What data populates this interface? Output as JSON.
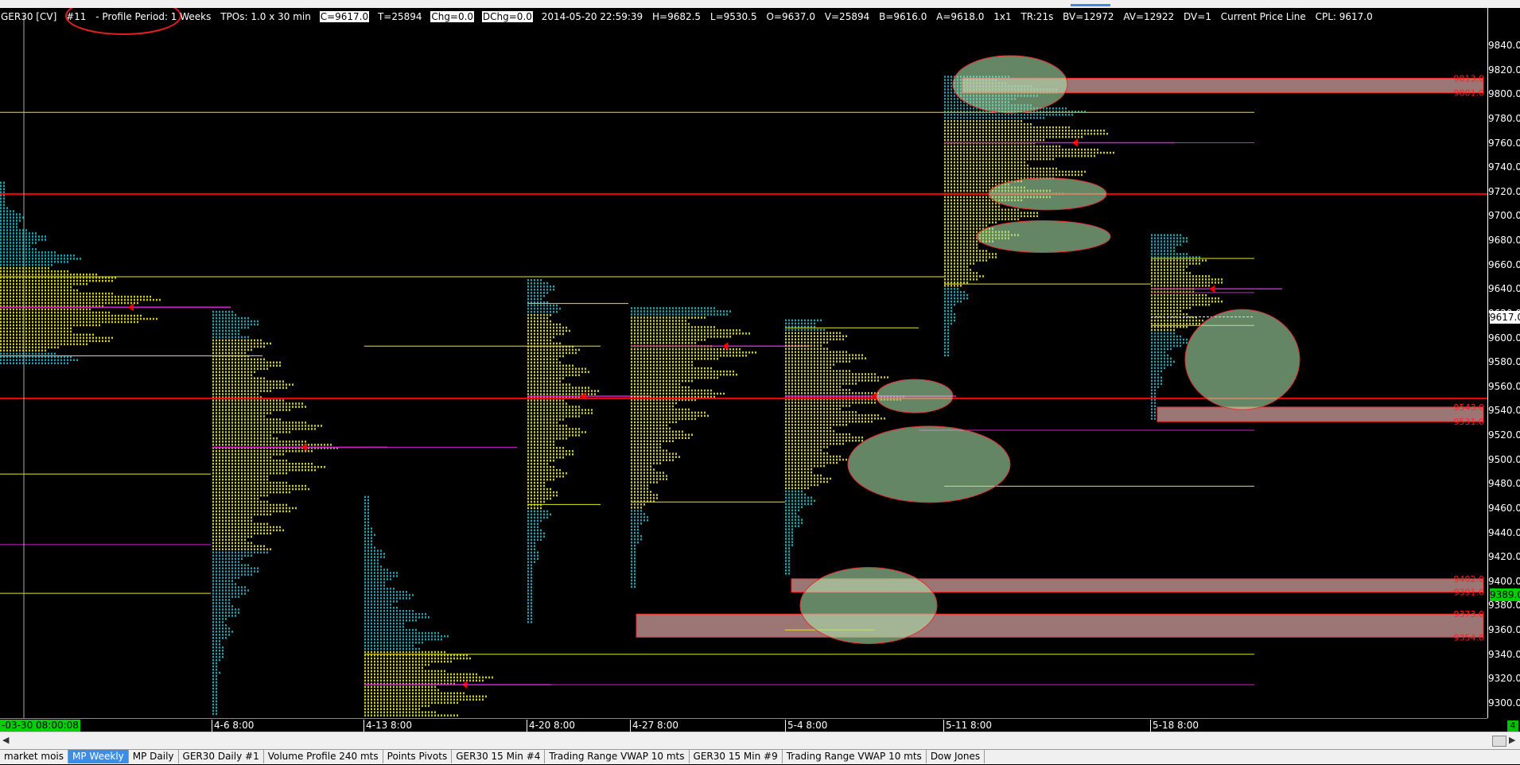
{
  "header": {
    "symbol": "GER30 [CV]",
    "chart_num": "#11",
    "profile_period": "- Profile Period: 1 Weeks",
    "tpos": "TPOs: 1.0 x 30 min",
    "close": "C=9617.0",
    "ticks": "T=25894",
    "chg": "Chg=0.0",
    "dchg": "DChg=0.0",
    "datetime": "2014-05-20 22:59:39",
    "high": "H=9682.5",
    "low": "L=9530.5",
    "open": "O=9637.0",
    "volume": "V=25894",
    "bid": "B=9616.0",
    "ask": "A=9618.0",
    "size": "1x1",
    "tr": "TR:21s",
    "bv": "BV=12972",
    "av": "AV=12922",
    "dv": "DV=1",
    "cpl_label": "Current Price Line",
    "cpl": "CPL: 9617.0"
  },
  "price_axis": {
    "ticks": [
      "9840.0",
      "9820.0",
      "9800.0",
      "9780.0",
      "9760.0",
      "9740.0",
      "9720.0",
      "9700.0",
      "9680.0",
      "9660.0",
      "9640.0",
      "9620.0",
      "9600.0",
      "9580.0",
      "9560.0",
      "9540.0",
      "9520.0",
      "9500.0",
      "9480.0",
      "9460.0",
      "9440.0",
      "9420.0",
      "9400.0",
      "9380.0",
      "9360.0",
      "9340.0",
      "9320.0",
      "9300.0"
    ],
    "current_price": "9617.0",
    "level_price": "9389.0"
  },
  "zone_labels": [
    "9813.0",
    "9801.0",
    "9543.0",
    "9531.0",
    "9402.0",
    "9391.0",
    "9373.0",
    "9354.0"
  ],
  "x_axis": {
    "labels": [
      "-03-30  08:00:08",
      "4-6  8:00",
      "4-13  8:00",
      "4-20  8:00",
      "4-27  8:00",
      "5-4  8:00",
      "5-11  8:00",
      "5-18  8:00"
    ],
    "corner": "4"
  },
  "tabs": [
    "market mois",
    "MP Weekly",
    "MP Daily",
    "GER30  Daily  #1",
    "Volume Profile 240 mts",
    "Points Pivots",
    "GER30  15 Min   #4",
    "Trading Range VWAP 10 mts",
    "GER30  15 Min   #9",
    "Trading Range VWAP 10 mts",
    "Dow Jones"
  ],
  "active_tab": "MP Weekly",
  "colors": {
    "background": "#000000",
    "profile_yellow": "#e6e61e",
    "profile_cyan": "#18c8d8",
    "poc_magenta": "#d020d0",
    "value_line": "#e6e61e",
    "level_red": "#ff0000",
    "zone_fill": "#f0b4b4",
    "ellipse_fill": "#a8e0a8"
  },
  "chart_data": {
    "type": "market-profile",
    "period": "1 Weeks",
    "y_range": [
      9290,
      9850
    ],
    "red_levels": [
      9718,
      9550
    ],
    "zones": [
      {
        "top": 9813,
        "bottom": 9801
      },
      {
        "top": 9543,
        "bottom": 9531
      },
      {
        "top": 9402,
        "bottom": 9391
      },
      {
        "top": 9373,
        "bottom": 9354
      }
    ]
  }
}
